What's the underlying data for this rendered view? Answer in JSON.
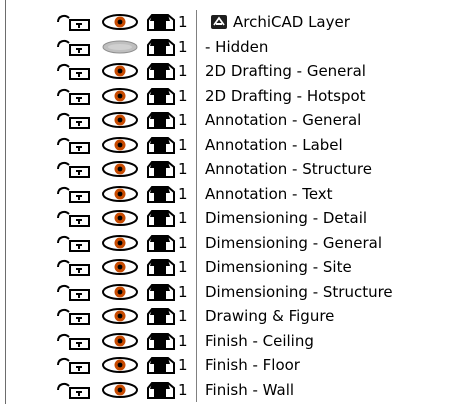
{
  "header": {
    "level": "1",
    "label": "ArchiCAD Layer"
  },
  "layers": [
    {
      "level": "1",
      "name": "- Hidden",
      "visible": false
    },
    {
      "level": "1",
      "name": "2D Drafting - General",
      "visible": true
    },
    {
      "level": "1",
      "name": "2D Drafting - Hotspot",
      "visible": true
    },
    {
      "level": "1",
      "name": "Annotation - General",
      "visible": true
    },
    {
      "level": "1",
      "name": "Annotation - Label",
      "visible": true
    },
    {
      "level": "1",
      "name": "Annotation - Structure",
      "visible": true
    },
    {
      "level": "1",
      "name": "Annotation - Text",
      "visible": true
    },
    {
      "level": "1",
      "name": "Dimensioning - Detail",
      "visible": true
    },
    {
      "level": "1",
      "name": "Dimensioning - General",
      "visible": true
    },
    {
      "level": "1",
      "name": "Dimensioning - Site",
      "visible": true
    },
    {
      "level": "1",
      "name": "Dimensioning - Structure",
      "visible": true
    },
    {
      "level": "1",
      "name": "Drawing & Figure",
      "visible": true
    },
    {
      "level": "1",
      "name": "Finish - Ceiling",
      "visible": true
    },
    {
      "level": "1",
      "name": "Finish - Floor",
      "visible": true
    },
    {
      "level": "1",
      "name": "Finish - Wall",
      "visible": true
    }
  ]
}
